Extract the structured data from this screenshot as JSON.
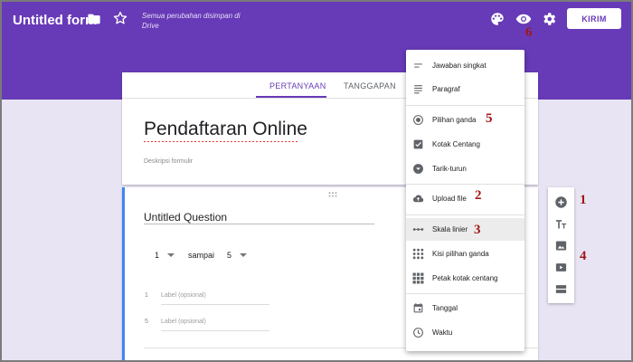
{
  "header": {
    "title": "Untitled form",
    "saved_status": "Semua perubahan disimpan di Drive",
    "send_label": "KIRIM"
  },
  "tabs": [
    "PERTANYAAN",
    "TANGGAPAN"
  ],
  "form": {
    "title": "Pendaftaran Online",
    "description_placeholder": "Deskripsi formulir"
  },
  "question": {
    "title": "Untitled Question",
    "scale_min": "1",
    "scale_to": "sampai",
    "scale_max": "5",
    "label_rows": [
      {
        "num": "1",
        "placeholder": "Label (opsional)"
      },
      {
        "num": "5",
        "placeholder": "Label (opsional)"
      }
    ]
  },
  "question_types": [
    {
      "label": "Jawaban singkat",
      "icon": "short-text-icon"
    },
    {
      "label": "Paragraf",
      "icon": "paragraph-icon"
    },
    {
      "label": "Pilihan ganda",
      "icon": "radio-icon"
    },
    {
      "label": "Kotak Centang",
      "icon": "checkbox-icon"
    },
    {
      "label": "Tarik-turun",
      "icon": "dropdown-icon"
    },
    {
      "label": "Upload file",
      "icon": "cloud-upload-icon"
    },
    {
      "label": "Skala linier",
      "icon": "linear-scale-icon"
    },
    {
      "label": "Kisi pilihan ganda",
      "icon": "grid-dots-icon"
    },
    {
      "label": "Petak kotak centang",
      "icon": "grid-squares-icon"
    },
    {
      "label": "Tanggal",
      "icon": "calendar-icon"
    },
    {
      "label": "Waktu",
      "icon": "clock-icon"
    }
  ],
  "annotations": [
    "1",
    "2",
    "3",
    "4",
    "5",
    "6"
  ],
  "colors": {
    "brand": "#673ab7",
    "accent": "#4285f4",
    "annotation": "#a01818"
  }
}
